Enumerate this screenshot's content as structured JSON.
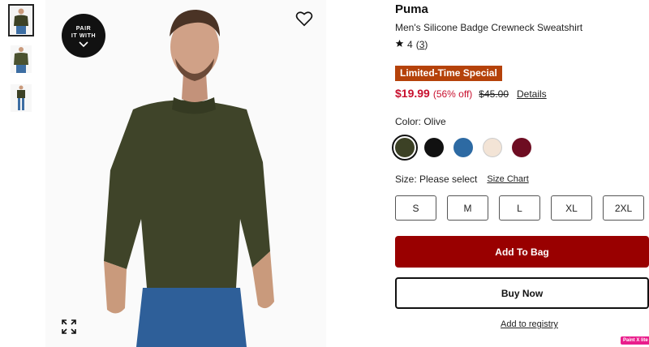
{
  "gallery": {
    "thumbnails": [
      {
        "alt": "product-front-thumbnail",
        "active": true
      },
      {
        "alt": "product-model-thumbnail",
        "active": false
      },
      {
        "alt": "product-full-body-thumbnail",
        "active": false
      }
    ],
    "pair_button_line1": "PAIR",
    "pair_button_line2": "IT WITH",
    "icons": {
      "favorite": "heart-icon",
      "expand": "expand-icon",
      "pair": "chevron-down-icon"
    }
  },
  "product": {
    "brand": "Puma",
    "title": "Men's Silicone Badge Crewneck Sweatshirt",
    "rating_value": "4",
    "review_count": "3",
    "promo_badge": "Limited-Time Special",
    "price": "$19.99",
    "discount": "(56% off)",
    "original_price": "$45.00",
    "details_link": "Details",
    "color_label": "Color: Olive",
    "colors": [
      {
        "name": "Olive",
        "hex": "#3c4125",
        "selected": true
      },
      {
        "name": "Black",
        "hex": "#111111",
        "selected": false
      },
      {
        "name": "Blue",
        "hex": "#2d6aa3",
        "selected": false
      },
      {
        "name": "Cream",
        "hex": "#f3e4d6",
        "selected": false
      },
      {
        "name": "Burgundy",
        "hex": "#6e0d22",
        "selected": false
      }
    ],
    "size_label": "Size: Please select",
    "size_chart_link": "Size Chart",
    "sizes": [
      "S",
      "M",
      "L",
      "XL",
      "2XL"
    ]
  },
  "actions": {
    "add_to_bag": "Add To Bag",
    "buy_now": "Buy Now",
    "add_to_registry": "Add to registry"
  },
  "badge": {
    "paint_label": "Paint X lite"
  },
  "colors": {
    "accent_red": "#990000",
    "price_red": "#c8102e",
    "promo": "#b5420a"
  }
}
